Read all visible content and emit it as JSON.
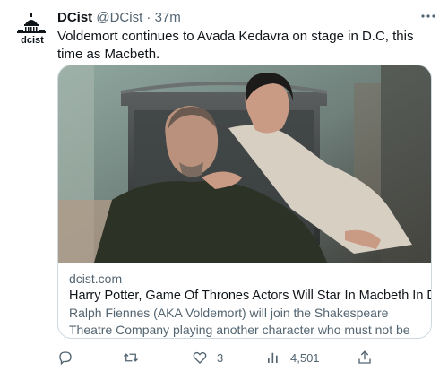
{
  "tweet": {
    "author": {
      "name": "DCist",
      "handle": "@DCist",
      "time": "37m",
      "avatar_text": "dcist"
    },
    "separator": "·",
    "text": "Voldemort continues to Avada Kedavra on stage in D.C, this time as Macbeth.",
    "card": {
      "domain": "dcist.com",
      "title": "Harry Potter, Game Of Thrones Actors Will Star In Macbeth In DC",
      "description": "Ralph Fiennes (AKA Voldemort) will join the Shakespeare Theatre Company playing another character who must not be named."
    },
    "actions": {
      "reply": {
        "icon": "reply-icon"
      },
      "retweet": {
        "icon": "retweet-icon"
      },
      "like": {
        "icon": "heart-icon",
        "count": "3"
      },
      "views": {
        "icon": "analytics-icon",
        "count": "4,501"
      },
      "share": {
        "icon": "share-icon"
      }
    }
  },
  "colors": {
    "text": "#0f1419",
    "secondary": "#536471",
    "border": "#cfd9de"
  }
}
